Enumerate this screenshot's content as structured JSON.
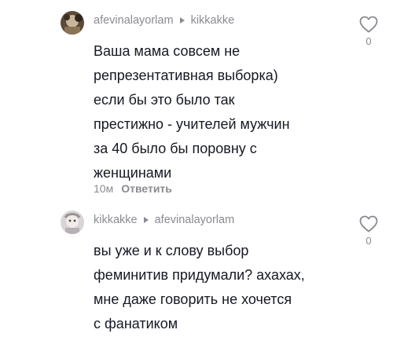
{
  "comments": [
    {
      "username": "afevinalayorlam",
      "reply_to": "kikkakke",
      "text": "Ваша мама совсем не\nрепрезентативная выборка)\nесли бы это было так\nпрестижно - учителей мужчин\nза 40 было бы поровну с\nженщинами",
      "time": "10м",
      "reply_label": "Ответить",
      "like_count": "0"
    },
    {
      "username": "kikkakke",
      "reply_to": "afevinalayorlam",
      "text": "вы уже и к слову выбор\nфеминитив придумали? ахахах,\nмне даже говорить не хочется\nс фанатиком",
      "like_count": "0"
    }
  ],
  "colors": {
    "text": "#161823",
    "muted": "#8a8b91"
  },
  "icons": {
    "like": "heart-outline-icon",
    "reply_arrow": "triangle-right-icon"
  }
}
